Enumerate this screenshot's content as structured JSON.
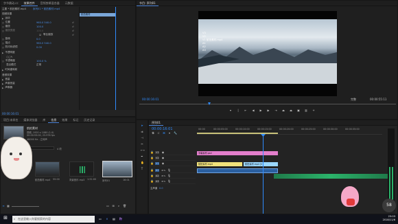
{
  "effect_controls": {
    "tabs": [
      "字节跳动.cc",
      "效果控件",
      "音频剪辑混合器",
      "元数据"
    ],
    "source_label": "主要 * 航拍素材.mp4",
    "seq_label": "序列01 * 航拍素材.mp4",
    "clip_label": "航拍素材",
    "section_video": "视频效果",
    "rows": [
      {
        "name": "运动",
        "value": ""
      },
      {
        "name": "位置",
        "value": "960.0    540.0"
      },
      {
        "name": "缩放",
        "value": "100.0"
      },
      {
        "name": "缩放宽度",
        "value": "100.0"
      },
      {
        "name": "等比缩放",
        "value": ""
      },
      {
        "name": "旋转",
        "value": "0.0"
      },
      {
        "name": "锚点",
        "value": "960.0    540.0"
      },
      {
        "name": "防闪烁滤镜",
        "value": "0.00"
      },
      {
        "name": "不透明度",
        "value": ""
      },
      {
        "name": "不透明度",
        "value": "100.0 %"
      },
      {
        "name": "混合模式",
        "value": "正常"
      },
      {
        "name": "时间重映射",
        "value": ""
      }
    ],
    "section_audio": "音频效果",
    "audio_rows": [
      {
        "name": "音量"
      },
      {
        "name": "声道音量"
      },
      {
        "name": "声像器"
      }
    ],
    "timecode": "00:00:16:01"
  },
  "mini_timeline": {
    "clip_label": "航拍素材"
  },
  "project_panel": {
    "tabs": [
      "项目:未命名",
      "媒体浏览器",
      "库",
      "信息",
      "效果",
      "标记",
      "历史记录"
    ],
    "asset_name": "航拍素材",
    "asset_info_1": "视频, 1920 x 1080 (1.0)",
    "asset_info_2": "00:00:55:00, 23.976 fps",
    "asset_info_3": "48000 Hz - 立体声",
    "item_count": "4 项",
    "thumbs": [
      {
        "name": "航拍素材.mp4",
        "time": "55:00"
      },
      {
        "name": "背景音乐.mp3",
        "time": "1:31:00"
      },
      {
        "name": "序列01",
        "time": "16:01"
      }
    ],
    "search_placeholder": ""
  },
  "program_monitor": {
    "title": "节目: 序列01",
    "timecode_left": "00:00:16:01",
    "timecode_right": "00:00:55:11",
    "fit_label": "完整",
    "overlay_lines": [
      "V3",
      "V2",
      "V1 航拍素材.mp4",
      "A1",
      "A2",
      "A3"
    ]
  },
  "timeline": {
    "tabs": [
      "序列01"
    ],
    "timecode": "00:00:16:01",
    "ruler": [
      "00:00",
      "00:00:05:00",
      "00:00:10:00",
      "00:00:15:00",
      "00:00:20:00",
      "00:00:25:00",
      "00:00:30:00",
      "00:00:35:00"
    ],
    "tracks_video": [
      "V3",
      "V2",
      "V1"
    ],
    "tracks_audio": [
      "A1",
      "A2",
      "A3"
    ],
    "master_label": "主声道",
    "master_value": "0.0",
    "clip_v2": "字幕素材.psd",
    "clip_v1a": "航拍素材.mp4",
    "clip_v1b": "航拍素材.mp4 [V]"
  },
  "taskbar": {
    "search_placeholder": "在这里输入你要搜索的内容",
    "time": "23:03",
    "date": "2018/11/6",
    "badge": "58"
  },
  "colors": {
    "accent": "#2f8cff",
    "clip_pink": "#e27ecb",
    "clip_video": "#9bd8ff",
    "clip_yellow": "#f1e27b",
    "audio_green": "#2bb36a"
  }
}
